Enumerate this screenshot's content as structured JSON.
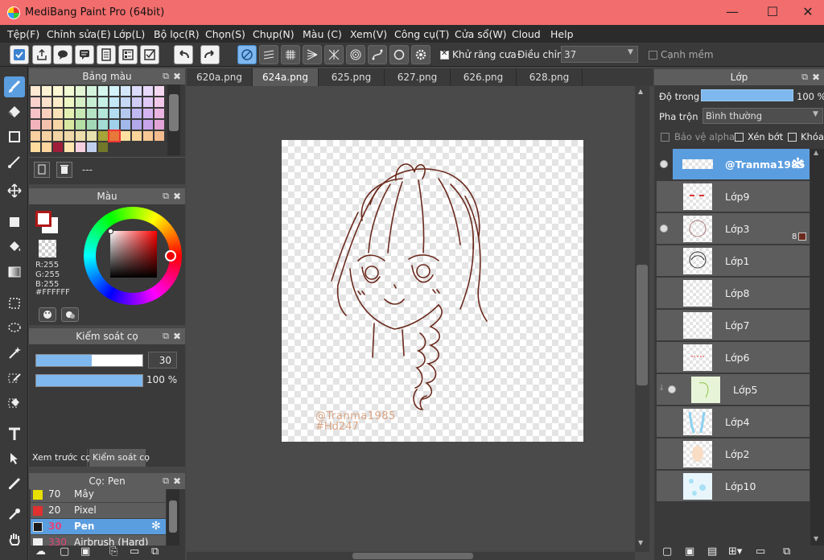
{
  "window": {
    "title": "MediBang Paint Pro (64bit)",
    "controls": {
      "minimize": "—",
      "maximize": "☐",
      "close": "✕"
    }
  },
  "menu": [
    "Tệp(F)",
    "Chỉnh sửa(E)",
    "Lớp(L)",
    "Bộ lọc(R)",
    "Chọn(S)",
    "Chụp(N)",
    "Màu (C)",
    "Xem(V)",
    "Công cụ(T)",
    "Cửa sổ(W)",
    "Cloud",
    "Help"
  ],
  "toolbar": {
    "antialias_label": "Khử răng cưa",
    "adjust_label": "Điều chỉnh",
    "adjust_value": "37",
    "soft_edge_label": "Cạnh mềm"
  },
  "palette_panel": {
    "title": "Bảng màu",
    "footer_text": "---"
  },
  "color_panel": {
    "title": "Màu",
    "r": "R:255",
    "g": "G:255",
    "b": "B:255",
    "hex": "#FFFFFF",
    "foreground": "#b01818",
    "background": "#ffffff"
  },
  "brush_control": {
    "title": "Kiểm soát cọ",
    "size_value": "30",
    "opacity_value": "100 %",
    "size_fraction": 0.52,
    "opacity_fraction": 1.0
  },
  "brush_tabs": [
    "Xem trước cọ",
    "Kiểm soát cọ"
  ],
  "brush_list": {
    "title": "Cọ: Pen",
    "items": [
      {
        "size": "70",
        "name": "Mây",
        "color": "#e8e000"
      },
      {
        "size": "20",
        "name": "Pixel",
        "color": "#e03030"
      },
      {
        "size": "30",
        "name": "Pen",
        "color": "#1a1a1a",
        "selected": true
      },
      {
        "size": "330",
        "name": "Airbrush (Hard)",
        "color": "#f0f0f0"
      }
    ]
  },
  "tabs": [
    "620a.png",
    "624a.png",
    "625.png",
    "627.png",
    "626.png",
    "628.png"
  ],
  "active_tab": "624a.png",
  "canvas_text": {
    "line1": "@Tranma1985",
    "line2": "#Hd247"
  },
  "layer_panel": {
    "title": "Lớp",
    "opacity_label": "Độ trong",
    "opacity_value": "100 %",
    "blend_label": "Pha trộn",
    "blend_value": "Bình thường",
    "protect_alpha": "Bảo vệ alpha",
    "clip": "Xén bớt",
    "lock": "Khóa",
    "layers": [
      {
        "name": "@Tranma1985",
        "visible": true,
        "selected": true
      },
      {
        "name": "Lớp9",
        "visible": false
      },
      {
        "name": "Lớp3",
        "visible": true,
        "badge": "8"
      },
      {
        "name": "Lớp1",
        "visible": false
      },
      {
        "name": "Lớp8",
        "visible": false
      },
      {
        "name": "Lớp7",
        "visible": false
      },
      {
        "name": "Lớp6",
        "visible": false
      },
      {
        "name": "Lớp5",
        "visible": true,
        "folder_child": true
      },
      {
        "name": "Lớp4",
        "visible": false
      },
      {
        "name": "Lớp2",
        "visible": false
      },
      {
        "name": "Lớp10",
        "visible": false
      }
    ]
  }
}
